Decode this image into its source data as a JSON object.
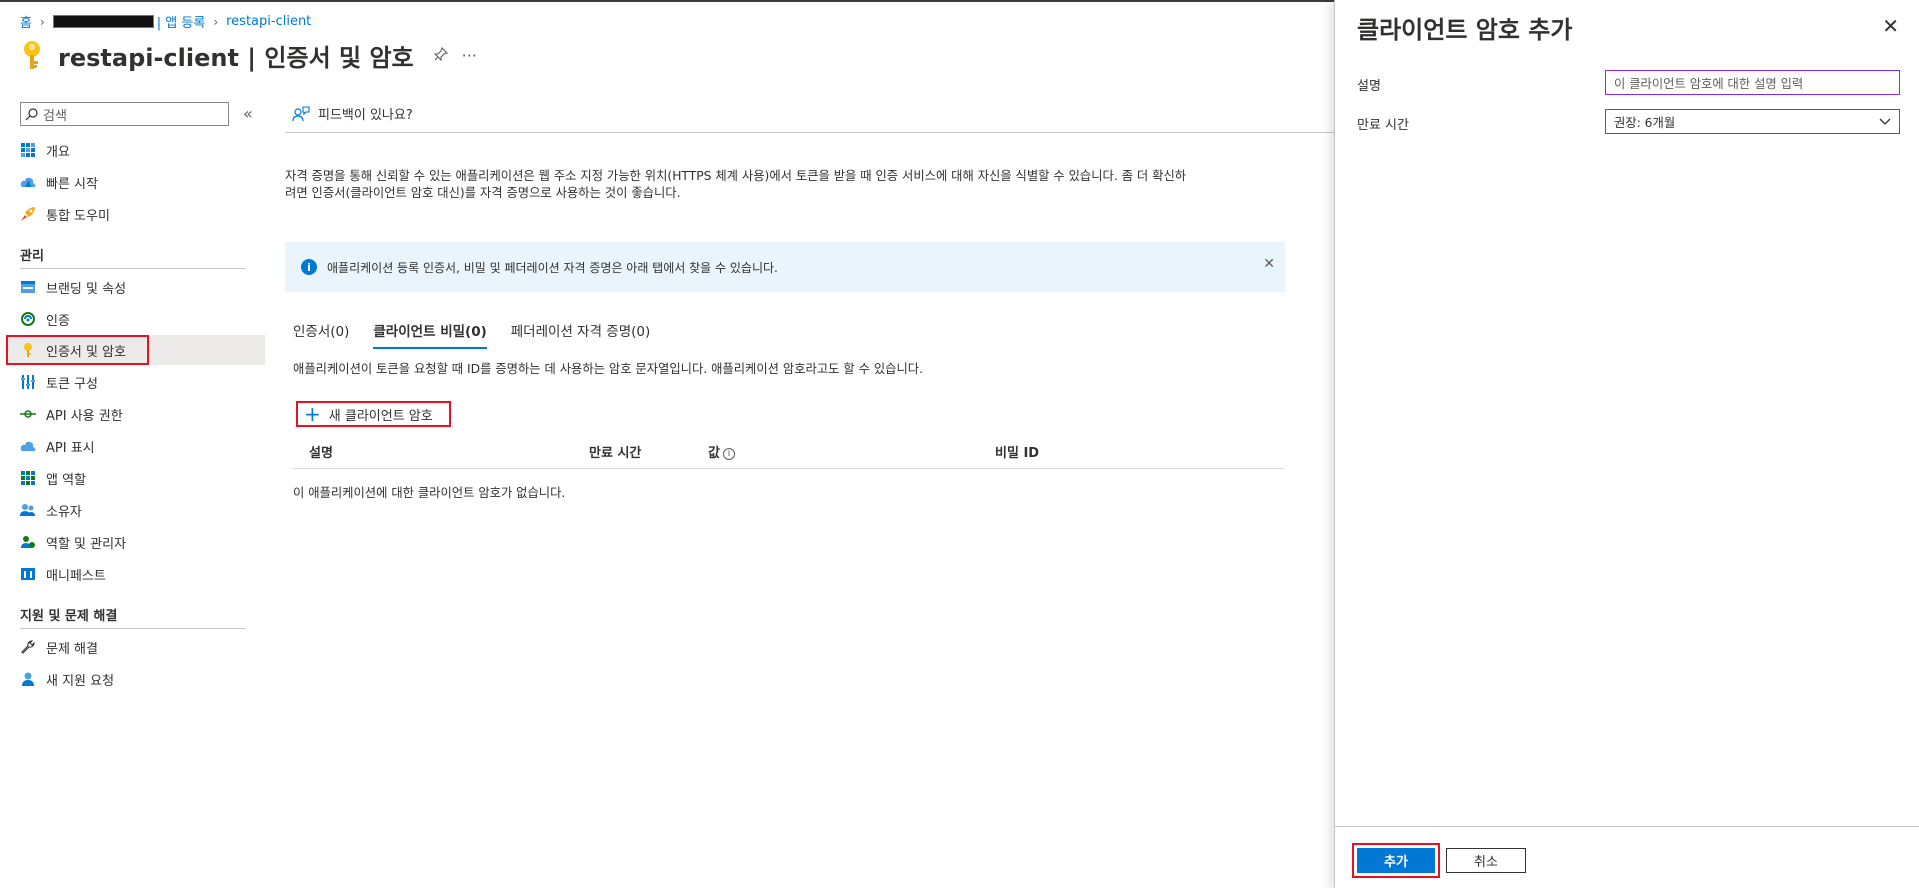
{
  "breadcrumb": {
    "home": "홈",
    "tenant_suffix": "| 앱 등록",
    "app": "restapi-client"
  },
  "header": {
    "title": "restapi-client | 인증서 및 암호"
  },
  "sidebar": {
    "search_placeholder": "검색",
    "collapse_symbol": "«",
    "items_top": [
      {
        "label": "개요",
        "icon": "overview-grid-icon"
      },
      {
        "label": "빠른 시작",
        "icon": "quickstart-cloud-icon"
      },
      {
        "label": "통합 도우미",
        "icon": "rocket-icon"
      }
    ],
    "section_manage": "관리",
    "items_manage": [
      {
        "label": "브랜딩 및 속성",
        "icon": "branding-icon"
      },
      {
        "label": "인증",
        "icon": "authentication-icon"
      },
      {
        "label": "인증서 및 암호",
        "icon": "key-icon"
      },
      {
        "label": "토큰 구성",
        "icon": "token-config-icon"
      },
      {
        "label": "API 사용 권한",
        "icon": "api-permissions-icon"
      },
      {
        "label": "API 표시",
        "icon": "expose-api-icon"
      },
      {
        "label": "앱 역할",
        "icon": "app-roles-icon"
      },
      {
        "label": "소유자",
        "icon": "owners-icon"
      },
      {
        "label": "역할 및 관리자",
        "icon": "roles-admins-icon"
      },
      {
        "label": "매니페스트",
        "icon": "manifest-icon"
      }
    ],
    "section_support": "지원 및 문제 해결",
    "items_support": [
      {
        "label": "문제 해결",
        "icon": "wrench-icon"
      },
      {
        "label": "새 지원 요청",
        "icon": "support-person-icon"
      }
    ]
  },
  "main": {
    "feedback_label": "피드백이 있나요?",
    "description_line1": "자격 증명을 통해 신뢰할 수 있는 애플리케이션은 웹 주소 지정 가능한 위치(HTTPS 체계 사용)에서 토큰을 받을 때 인증 서비스에 대해 자신을 식별할 수 있습니다. 좀 더 확신하",
    "description_line2": "려면 인증서(클라이언트 암호 대신)를 자격 증명으로 사용하는 것이 좋습니다.",
    "info_banner": "애플리케이션 등록 인증서, 비밀 및 페더레이션 자격 증명은 아래 탭에서 찾을 수 있습니다.",
    "tabs": [
      {
        "label": "인증서(0)"
      },
      {
        "label": "클라이언트 비밀(0)"
      },
      {
        "label": "페더레이션 자격 증명(0)"
      }
    ],
    "tab_description": "애플리케이션이 토큰을 요청할 때 ID를 증명하는 데 사용하는 암호 문자열입니다. 애플리케이션 암호라고도 할 수 있습니다.",
    "new_secret_label": "새 클라이언트 암호",
    "table_headers": {
      "description": "설명",
      "expires": "만료 시간",
      "value": "값",
      "secret_id": "비밀 ID"
    },
    "empty_message": "이 애플리케이션에 대한 클라이언트 암호가 없습니다."
  },
  "panel": {
    "title": "클라이언트 암호 추가",
    "description_label": "설명",
    "description_placeholder": "이 클라이언트 암호에 대한 설명 입력",
    "expires_label": "만료 시간",
    "expires_value": "권장: 6개월",
    "add_button": "추가",
    "cancel_button": "취소"
  },
  "colors": {
    "accent": "#0078d4",
    "highlight": "#e81123",
    "input_border": "#8a2be2",
    "info_bg": "#eaf4fc"
  }
}
